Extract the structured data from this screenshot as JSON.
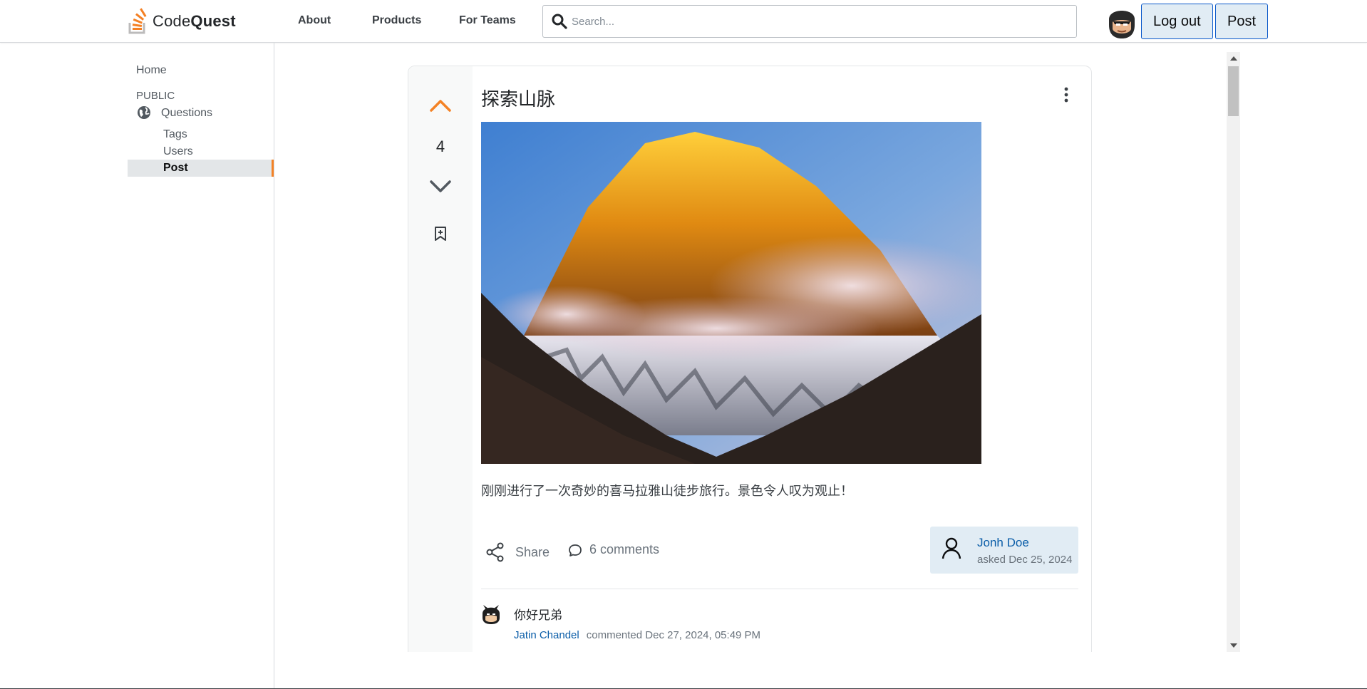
{
  "header": {
    "brand_prefix": "Code",
    "brand_suffix": "Quest",
    "nav": [
      "About",
      "Products",
      "For Teams"
    ],
    "search_placeholder": "Search...",
    "logout_label": "Log out",
    "post_label": "Post"
  },
  "sidebar": {
    "home": "Home",
    "section": "PUBLIC",
    "questions": "Questions",
    "tags": "Tags",
    "users": "Users",
    "post": "Post"
  },
  "post": {
    "title": "探索山脉",
    "votes": "4",
    "body": "刚刚进行了一次奇妙的喜马拉雅山徒步旅行。景色令人叹为观止！",
    "share_label": "Share",
    "comments_label": "6 comments",
    "author": "Jonh Doe",
    "asked": "asked Dec 25, 2024"
  },
  "comments": [
    {
      "text": "你好兄弟",
      "user": "Jatin Chandel",
      "meta": "commented Dec 27, 2024, 05:49 PM"
    }
  ],
  "colors": {
    "accent": "#f48225",
    "link": "#0a5da8",
    "button_border": "#0a58ca",
    "button_bg": "#e1ecf4"
  }
}
